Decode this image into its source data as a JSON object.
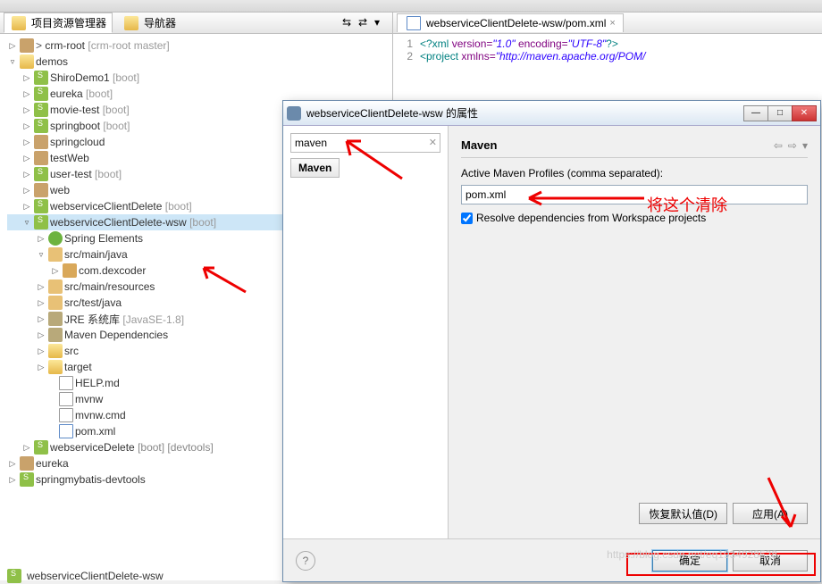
{
  "left_panel": {
    "tab1": "项目资源管理器",
    "tab2": "导航器"
  },
  "tree": {
    "n0": {
      "name": "crm-root",
      "deco": "[crm-root master]"
    },
    "n1": {
      "name": "demos"
    },
    "n2": {
      "name": "ShiroDemo1",
      "deco": "[boot]"
    },
    "n3": {
      "name": "eureka",
      "deco": "[boot]"
    },
    "n4": {
      "name": "movie-test",
      "deco": "[boot]"
    },
    "n5": {
      "name": "springboot",
      "deco": "[boot]"
    },
    "n6": {
      "name": "springcloud"
    },
    "n7": {
      "name": "testWeb"
    },
    "n8": {
      "name": "user-test",
      "deco": "[boot]"
    },
    "n9": {
      "name": "web"
    },
    "n10": {
      "name": "webserviceClientDelete",
      "deco": "[boot]"
    },
    "n11": {
      "name": "webserviceClientDelete-wsw",
      "deco": "[boot]"
    },
    "n12": {
      "name": "Spring Elements"
    },
    "n13": {
      "name": "src/main/java"
    },
    "n14": {
      "name": "com.dexcoder"
    },
    "n15": {
      "name": "src/main/resources"
    },
    "n16": {
      "name": "src/test/java"
    },
    "n17": {
      "name": "JRE 系统库",
      "deco": "[JavaSE-1.8]"
    },
    "n18": {
      "name": "Maven Dependencies"
    },
    "n19": {
      "name": "src"
    },
    "n20": {
      "name": "target"
    },
    "n21": {
      "name": "HELP.md"
    },
    "n22": {
      "name": "mvnw"
    },
    "n23": {
      "name": "mvnw.cmd"
    },
    "n24": {
      "name": "pom.xml"
    },
    "n25": {
      "name": "webserviceDelete",
      "deco": "[boot] [devtools]"
    },
    "n26": {
      "name": "eureka"
    },
    "n27": {
      "name": "springmybatis-devtools"
    },
    "status": "webserviceClientDelete-wsw"
  },
  "editor": {
    "tab": "webserviceClientDelete-wsw/pom.xml",
    "line1": {
      "num": "1",
      "text_a": "<?xml",
      "attr1": "version=",
      "val1": "\"1.0\"",
      "attr2": "encoding=",
      "val2": "\"UTF-8\"",
      "text_b": "?>"
    },
    "line2": {
      "num": "2",
      "text_a": "<project",
      "attr1": "xmlns=",
      "val1": "\"http://maven.apache.org/POM/"
    }
  },
  "dialog": {
    "title": "webserviceClientDelete-wsw 的属性",
    "filter_value": "maven",
    "category": "Maven",
    "heading": "Maven",
    "profiles_label": "Active Maven Profiles (comma separated):",
    "profiles_value": "pom.xml",
    "resolve_label": "Resolve dependencies from Workspace projects",
    "restore_btn": "恢复默认值(D)",
    "apply_btn": "应用(A)",
    "ok_btn": "确定",
    "cancel_btn": "取消"
  },
  "annotation": {
    "text": "将这个清除"
  },
  "watermark": "https://blog.csdn.net/eq1934928528"
}
